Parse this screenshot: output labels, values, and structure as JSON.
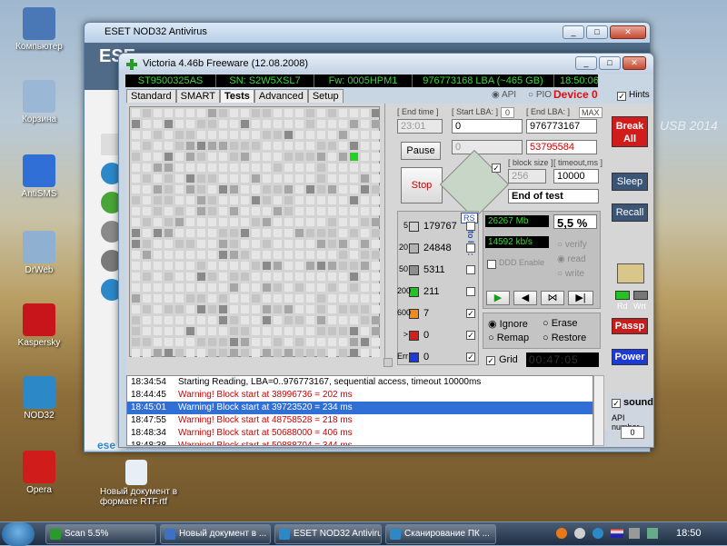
{
  "desktop": {
    "icons": [
      {
        "label": "Компьютер",
        "color": "#4a78b6"
      },
      {
        "label": "Корзина",
        "color": "#9ab7d6"
      },
      {
        "label": "AntiSMS",
        "color": "#2f6fd6"
      },
      {
        "label": "DrWeb",
        "color": "#8fb0d0"
      },
      {
        "label": "Kaspersky",
        "color": "#c8151b"
      },
      {
        "label": "NOD32",
        "color": "#2d88c8"
      },
      {
        "label": "Opera",
        "color": "#d11c1c"
      },
      {
        "label": "Новый документ в формате RTF.rtf",
        "color": "#e8eef5"
      }
    ],
    "watermark": "USB 2014"
  },
  "eset": {
    "title": "ESET NOD32 Antivirus",
    "brand": "ESE",
    "footer": "ese"
  },
  "victoria": {
    "title": "Victoria 4.46b Freeware (12.08.2008)",
    "info": {
      "model": "ST9500325AS",
      "sn": "SN: S2W5XSL7",
      "fw": "Fw: 0005HPM1",
      "lba": "976773168 LBA (~465 GB)",
      "time": "18:50:06"
    },
    "tabs": [
      "Standard",
      "SMART",
      "Tests",
      "Advanced",
      "Setup"
    ],
    "apm": {
      "api": "API",
      "pio": "PIO",
      "device": "Device 0",
      "hints": "Hints"
    },
    "fields": {
      "end_time_label": "[ End time ]",
      "end_time": "23:01",
      "start_lba_label": "[ Start LBA: ]",
      "start_lba_zero": "0",
      "start_lba": "0",
      "end_lba_label": "[ End LBA: ]",
      "end_lba_max": "MAX",
      "end_lba": "976773167",
      "current": "53795584",
      "block_size_label": "[ block size ]",
      "block_size": "256",
      "timeout_label": "[ timeout,ms ]",
      "timeout": "10000",
      "mode": "End of test"
    },
    "buttons": {
      "pause": "Pause",
      "stop": "Stop",
      "break_all": "Break All",
      "sleep": "Sleep",
      "recall": "Recall",
      "passp": "Passp",
      "power": "Power",
      "rd": "Rd",
      "wrt": "Wrt"
    },
    "stats": {
      "rs": "RS",
      "to_log": "to log:",
      "rows": [
        {
          "ms": "5",
          "count": "179767",
          "color": "#d0d0d0",
          "log": false
        },
        {
          "ms": "20",
          "count": "24848",
          "color": "#b2b2b2",
          "log": false
        },
        {
          "ms": "50",
          "count": "5311",
          "color": "#8e8e8e",
          "log": false
        },
        {
          "ms": "200",
          "count": "211",
          "color": "#22c322",
          "log": false
        },
        {
          "ms": "600",
          "count": "7",
          "color": "#f08a1a",
          "log": true
        },
        {
          "ms": ">",
          "count": "0",
          "color": "#d61d1d",
          "log": true
        },
        {
          "ms": "Err",
          "count": "0",
          "color": "#1d3ad6",
          "log": true
        }
      ]
    },
    "speed": {
      "mb": "26267",
      "mb_unit": "Mb",
      "pct": "5,5",
      "pct_unit": "%",
      "kbs": "14592",
      "kbs_unit": "kb/s",
      "ddd": "DDD Enable",
      "verify": "verify",
      "read": "read",
      "write": "write"
    },
    "actions": {
      "ignore": "Ignore",
      "erase": "Erase",
      "remap": "Remap",
      "restore": "Restore",
      "grid": "Grid",
      "timer": "00:47:05"
    },
    "sound": {
      "label": "sound",
      "api_number": "API number",
      "value": "0"
    },
    "log": [
      {
        "time": "18:34:54",
        "msg": "Starting Reading, LBA=0..976773167, sequential access, timeout 10000ms",
        "type": "info"
      },
      {
        "time": "18:44:45",
        "msg": "Warning! Block start at 38996736 = 202 ms",
        "type": "warn"
      },
      {
        "time": "18:45:01",
        "msg": "Warning! Block start at 39723520 = 234 ms",
        "type": "sel"
      },
      {
        "time": "18:47:55",
        "msg": "Warning! Block start at 48758528 = 218 ms",
        "type": "warn"
      },
      {
        "time": "18:48:34",
        "msg": "Warning! Block start at 50688000 = 406 ms",
        "type": "warn"
      },
      {
        "time": "18:48:38",
        "msg": "Warning! Block start at 50888704 = 344 ms",
        "type": "warn"
      }
    ]
  },
  "taskbar": {
    "items": [
      {
        "label": "Scan 5.5%",
        "color": "#2a9a2a"
      },
      {
        "label": "Новый документ в ...",
        "color": "#3b72c4"
      },
      {
        "label": "ESET NOD32 Antivirus",
        "color": "#2d88c8"
      },
      {
        "label": "Сканирование ПК ...",
        "color": "#2d88c8"
      }
    ],
    "clock": "18:50"
  }
}
